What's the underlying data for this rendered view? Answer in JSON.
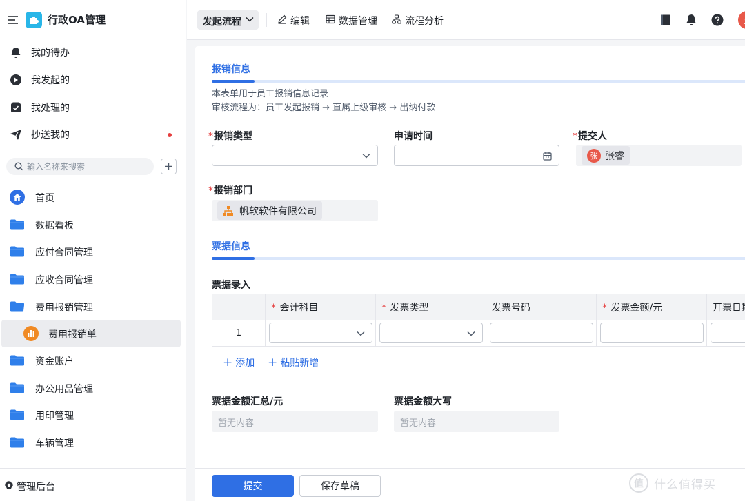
{
  "app": {
    "name": "行政OA管理",
    "accent": "#2f6fe4",
    "logo_color": "#29b6e8"
  },
  "sidebar": {
    "quick": [
      {
        "label": "我的待办",
        "icon": "bell-icon"
      },
      {
        "label": "我发起的",
        "icon": "play-circle-icon"
      },
      {
        "label": "我处理的",
        "icon": "checkbox-icon"
      },
      {
        "label": "抄送我的",
        "icon": "send-icon",
        "badge": "unread-dot"
      }
    ],
    "search": {
      "placeholder": "输入名称来搜索"
    },
    "tree": [
      {
        "label": "首页",
        "icon": "home-icon"
      },
      {
        "label": "数据看板",
        "icon": "folder-icon"
      },
      {
        "label": "应付合同管理",
        "icon": "folder-icon"
      },
      {
        "label": "应收合同管理",
        "icon": "folder-icon"
      },
      {
        "label": "费用报销管理",
        "icon": "folder-icon"
      },
      {
        "label": "费用报销单",
        "icon": "chart-icon",
        "active": true
      },
      {
        "label": "资金账户",
        "icon": "folder-icon"
      },
      {
        "label": "办公用品管理",
        "icon": "folder-icon"
      },
      {
        "label": "用印管理",
        "icon": "folder-icon"
      },
      {
        "label": "车辆管理",
        "icon": "folder-icon"
      }
    ],
    "footer": {
      "label": "管理后台",
      "icon": "gear-icon"
    }
  },
  "toolbar": {
    "start": "发起流程",
    "actions": [
      {
        "label": "编辑",
        "icon": "pencil-icon"
      },
      {
        "label": "数据管理",
        "icon": "table-icon"
      },
      {
        "label": "流程分析",
        "icon": "flow-icon"
      }
    ],
    "avatar_text": "张"
  },
  "form": {
    "section1": {
      "title": "报销信息",
      "desc_line1": "本表单用于员工报销信息记录",
      "desc_line2": "审核流程为：员工发起报销 → 直属上级审核 → 出纳付款"
    },
    "fields": {
      "type": {
        "label": "报销类型",
        "required": "*",
        "value": ""
      },
      "time": {
        "label": "申请时间",
        "value": ""
      },
      "submitter": {
        "label": "提交人",
        "required": "*",
        "value": "张睿",
        "avatar": "张"
      },
      "dept": {
        "label": "报销部门",
        "required": "*",
        "value": "帆软软件有限公司"
      }
    },
    "section2": {
      "title": "票据信息"
    },
    "table": {
      "label": "票据录入",
      "columns": [
        {
          "label": "",
          "required": ""
        },
        {
          "label": "会计科目",
          "required": "*"
        },
        {
          "label": "发票类型",
          "required": "*"
        },
        {
          "label": "发票号码",
          "required": ""
        },
        {
          "label": "发票金额/元",
          "required": "*"
        },
        {
          "label": "开票日期",
          "required": ""
        }
      ],
      "rows": [
        {
          "index": "1"
        }
      ],
      "add": "添加",
      "paste": "粘贴新增"
    },
    "summary": {
      "total": {
        "label": "票据金额汇总/元",
        "value": "暂无内容"
      },
      "upper": {
        "label": "票据金额大写",
        "value": "暂无内容"
      }
    }
  },
  "footer": {
    "submit": "提交",
    "save_draft": "保存草稿"
  },
  "watermark": {
    "text": "什么值得买",
    "mark": "值"
  }
}
